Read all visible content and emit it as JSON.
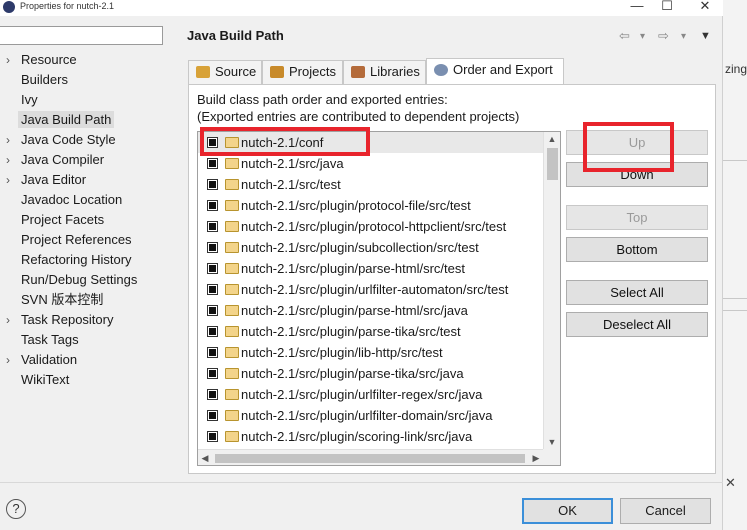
{
  "window": {
    "title": "Properties for nutch-2.1",
    "close": "✕",
    "minimize": "—",
    "maximize": "☐"
  },
  "sidebar": {
    "filter_value": "",
    "items": [
      {
        "label": "Resource",
        "arrow": "›"
      },
      {
        "label": "Builders",
        "arrow": ""
      },
      {
        "label": "Ivy",
        "arrow": ""
      },
      {
        "label": "Java Build Path",
        "arrow": "",
        "selected": true
      },
      {
        "label": "Java Code Style",
        "arrow": "›"
      },
      {
        "label": "Java Compiler",
        "arrow": "›"
      },
      {
        "label": "Java Editor",
        "arrow": "›"
      },
      {
        "label": "Javadoc Location",
        "arrow": ""
      },
      {
        "label": "Project Facets",
        "arrow": ""
      },
      {
        "label": "Project References",
        "arrow": ""
      },
      {
        "label": "Refactoring History",
        "arrow": ""
      },
      {
        "label": "Run/Debug Settings",
        "arrow": ""
      },
      {
        "label": "SVN 版本控制",
        "arrow": ""
      },
      {
        "label": "Task Repository",
        "arrow": "›"
      },
      {
        "label": "Task Tags",
        "arrow": ""
      },
      {
        "label": "Validation",
        "arrow": "›"
      },
      {
        "label": "WikiText",
        "arrow": ""
      }
    ]
  },
  "header": {
    "title": "Java Build Path",
    "back": "⇦",
    "forward": "⇨",
    "dropdown": "▾",
    "menu": "▼"
  },
  "tabs": [
    {
      "label": "Source",
      "icon": "source-folder-icon",
      "active": false
    },
    {
      "label": "Projects",
      "icon": "projects-icon",
      "active": false
    },
    {
      "label": "Libraries",
      "icon": "libraries-icon",
      "active": false
    },
    {
      "label": "Order and Export",
      "icon": "order-export-icon",
      "active": true
    }
  ],
  "panel": {
    "line1": "Build class path order and exported entries:",
    "line2": "(Exported entries are contributed to dependent projects)"
  },
  "entries": [
    "nutch-2.1/conf",
    "nutch-2.1/src/java",
    "nutch-2.1/src/test",
    "nutch-2.1/src/plugin/protocol-file/src/test",
    "nutch-2.1/src/plugin/protocol-httpclient/src/test",
    "nutch-2.1/src/plugin/subcollection/src/test",
    "nutch-2.1/src/plugin/parse-html/src/test",
    "nutch-2.1/src/plugin/urlfilter-automaton/src/test",
    "nutch-2.1/src/plugin/parse-html/src/java",
    "nutch-2.1/src/plugin/parse-tika/src/test",
    "nutch-2.1/src/plugin/lib-http/src/test",
    "nutch-2.1/src/plugin/parse-tika/src/java",
    "nutch-2.1/src/plugin/urlfilter-regex/src/java",
    "nutch-2.1/src/plugin/urlfilter-domain/src/java",
    "nutch-2.1/src/plugin/scoring-link/src/java"
  ],
  "buttons": {
    "up": "Up",
    "down": "Down",
    "top": "Top",
    "bottom": "Bottom",
    "select_all": "Select All",
    "deselect_all": "Deselect All"
  },
  "footer": {
    "help": "?",
    "ok": "OK",
    "cancel": "Cancel"
  },
  "right_strip": {
    "text": "zing"
  },
  "colors": {
    "highlight": "#e8242c",
    "accent": "#3b8fd9"
  }
}
